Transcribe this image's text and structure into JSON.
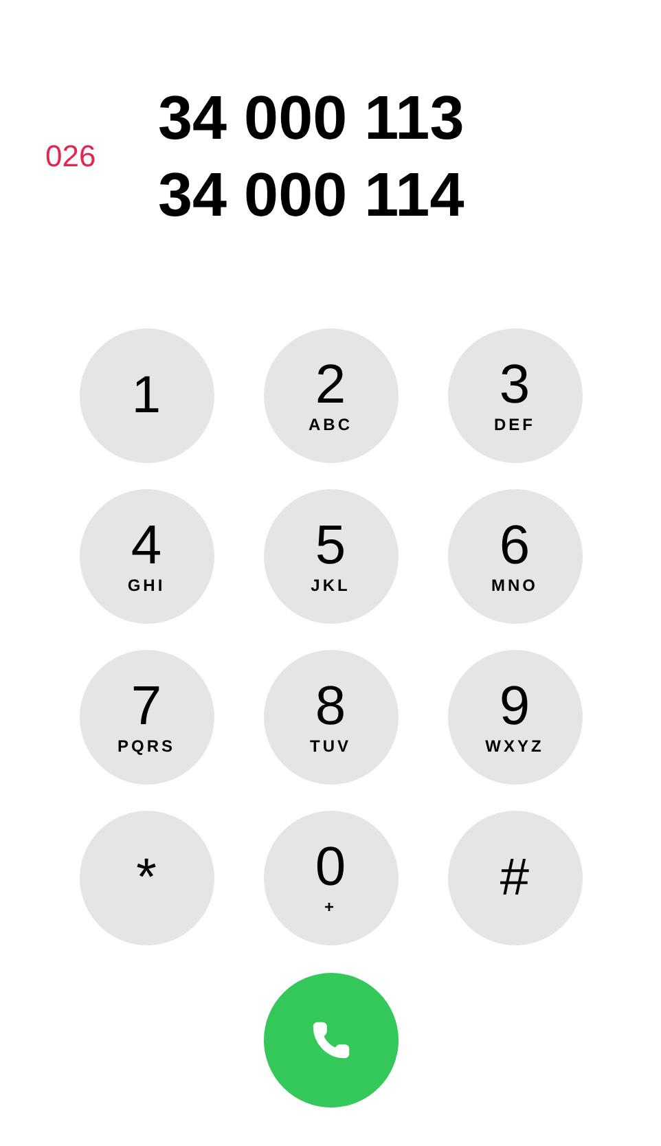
{
  "prefix": "026",
  "numbers": [
    "34 000 113",
    "34 000 114"
  ],
  "keys": [
    {
      "digit": "1"
    },
    {
      "digit": "2",
      "letters": "ABC"
    },
    {
      "digit": "3",
      "letters": "DEF"
    },
    {
      "digit": "4",
      "letters": "GHI"
    },
    {
      "digit": "5",
      "letters": "JKL"
    },
    {
      "digit": "6",
      "letters": "MNO"
    },
    {
      "digit": "7",
      "letters": "PQRS"
    },
    {
      "digit": "8",
      "letters": "TUV"
    },
    {
      "digit": "9",
      "letters": "WXYZ"
    },
    {
      "digit": "*"
    },
    {
      "digit": "0",
      "letters": "+"
    },
    {
      "digit": "#"
    }
  ]
}
